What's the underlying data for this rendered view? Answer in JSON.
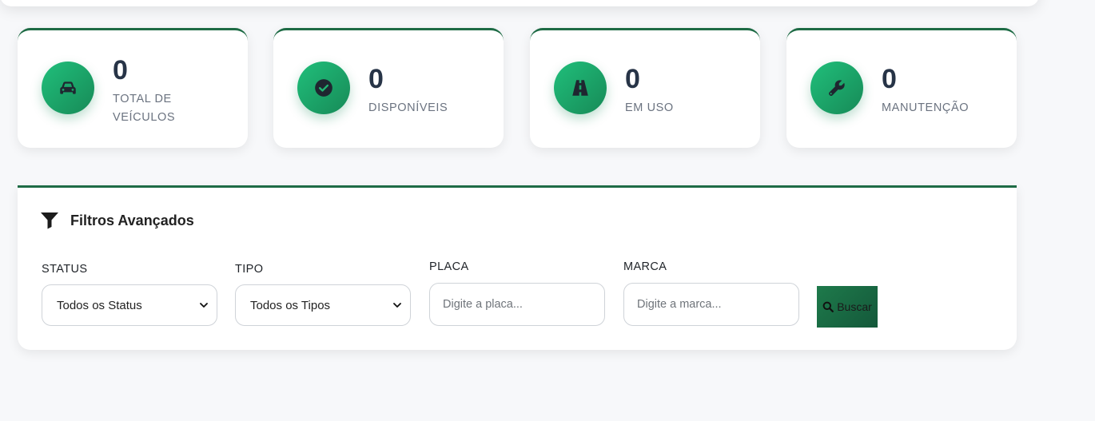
{
  "stats": [
    {
      "value": "0",
      "label_line1": "TOTAL DE",
      "label_line2": "VEÍCULOS",
      "icon": "car-icon"
    },
    {
      "value": "0",
      "label": "DISPONÍVEIS",
      "icon": "check-circle-icon"
    },
    {
      "value": "0",
      "label": "EM USO",
      "icon": "road-icon"
    },
    {
      "value": "0",
      "label": "MANUTENÇÃO",
      "icon": "wrench-icon"
    }
  ],
  "filters": {
    "title": "Filtros Avançados",
    "status": {
      "label": "STATUS",
      "value": "Todos os Status"
    },
    "tipo": {
      "label": "TIPO",
      "value": "Todos os Tipos"
    },
    "placa": {
      "label": "PLACA",
      "placeholder": "Digite a placa..."
    },
    "marca": {
      "label": "MARCA",
      "placeholder": "Digite a marca..."
    },
    "search_label": "Buscar"
  },
  "colors": {
    "accent": "#1e6b45",
    "icon_gradient_start": "#20bf7b",
    "icon_gradient_end": "#178a57",
    "number": "#273447",
    "label": "#6b7380",
    "background": "#f7f8fa"
  }
}
